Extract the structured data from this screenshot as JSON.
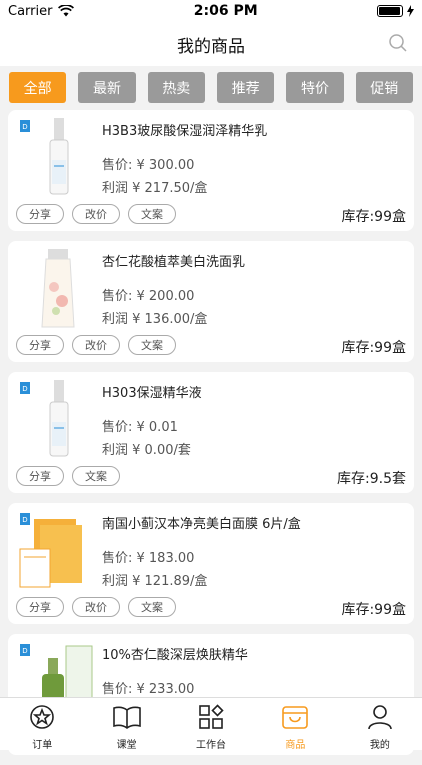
{
  "status": {
    "carrier": "Carrier",
    "time": "2:06 PM"
  },
  "header": {
    "title": "我的商品"
  },
  "filters": [
    "全部",
    "最新",
    "热卖",
    "推荐",
    "特价",
    "促销"
  ],
  "products": [
    {
      "name": "H3B3玻尿酸保湿润泽精华乳",
      "price": "售价: ¥ 300.00",
      "profit": "利润 ¥ 217.50/盒",
      "buttons": [
        "分享",
        "改价",
        "文案"
      ],
      "stock": "库存:99盒",
      "icon": "serum-bottle-icon"
    },
    {
      "name": "杏仁花酸植萃美白洗面乳",
      "price": "售价: ¥ 200.00",
      "profit": "利润 ¥ 136.00/盒",
      "buttons": [
        "分享",
        "改价",
        "文案"
      ],
      "stock": "库存:99盒",
      "icon": "cleanser-tube-icon"
    },
    {
      "name": "H303保湿精华液",
      "price": "售价: ¥ 0.01",
      "profit": "利润 ¥ 0.00/套",
      "buttons": [
        "分享",
        "文案"
      ],
      "stock": "库存:9.5套",
      "icon": "serum-bottle-icon"
    },
    {
      "name": "南国小蓟汉本净亮美白面膜 6片/盒",
      "price": "售价: ¥ 183.00",
      "profit": "利润 ¥ 121.89/盒",
      "buttons": [
        "分享",
        "改价",
        "文案"
      ],
      "stock": "库存:99盒",
      "icon": "mask-box-icon"
    },
    {
      "name": "10%杏仁酸深层焕肤精华",
      "price": "售价: ¥ 233.00",
      "profit": "",
      "buttons": [],
      "stock": "",
      "icon": "dropper-bottle-icon"
    }
  ],
  "tabbar": [
    {
      "label": "订单",
      "icon": "star-circle-icon"
    },
    {
      "label": "课堂",
      "icon": "book-icon"
    },
    {
      "label": "工作台",
      "icon": "workbench-icon"
    },
    {
      "label": "商品",
      "icon": "shop-bag-icon",
      "active": true
    },
    {
      "label": "我的",
      "icon": "user-icon"
    }
  ],
  "colors": {
    "accent": "#f79a1d",
    "chip_inactive": "#9a9a9a"
  }
}
